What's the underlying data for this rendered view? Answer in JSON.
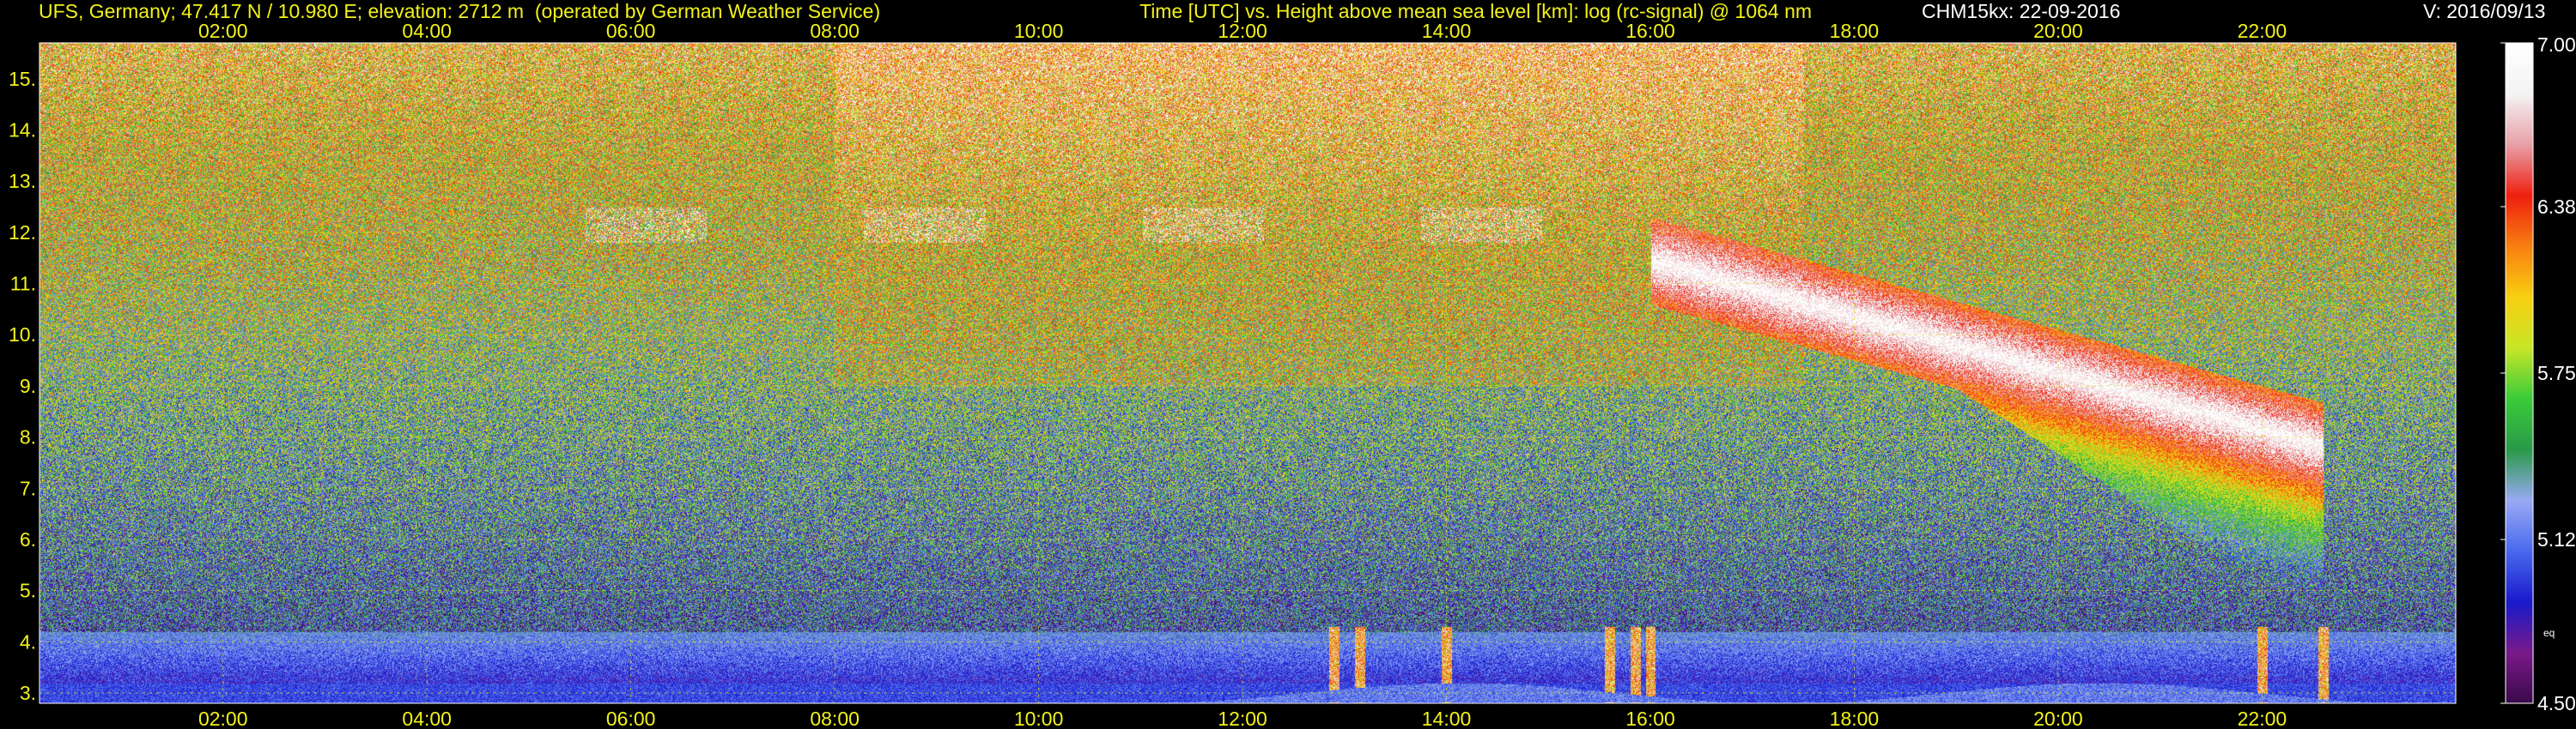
{
  "header": {
    "site": "UFS, Germany; 47.417 N / 10.980 E; elevation: 2712 m  (operated by German Weather Service)",
    "plot_title": "Time [UTC] vs. Height above mean sea level [km]: log (rc-signal) @ 1064 nm",
    "instrument": "CHM15kx: 22-09-2016",
    "version": "V: 2016/09/13"
  },
  "colors": {
    "background": "#000000",
    "axis_text": "#f2f21a",
    "grid": "#e0e020",
    "plot_frame": "#ffffff",
    "colorbar_stops": [
      "#3a0a4a",
      "#7a1a8a",
      "#1a1acc",
      "#4a6aee",
      "#9aaaf4",
      "#2a9a4a",
      "#3acc3a",
      "#c8e628",
      "#f8d010",
      "#f88010",
      "#f02010",
      "#e8a0a8",
      "#f4f4f4",
      "#ffffff"
    ]
  },
  "chart_data": {
    "type": "heatmap",
    "title": "Time [UTC] vs. Height above mean sea level [km]: log (rc-signal) @ 1064 nm",
    "x_axis": {
      "label": "Time [UTC]",
      "ticks": [
        "02:00",
        "04:00",
        "06:00",
        "08:00",
        "10:00",
        "12:00",
        "14:00",
        "16:00",
        "18:00",
        "20:00",
        "22:00"
      ],
      "range_hours": [
        0.2,
        23.9
      ],
      "grid": true
    },
    "y_axis": {
      "label": "Height above mean sea level [km]",
      "ticks": [
        "3.",
        "4.",
        "5.",
        "6.",
        "7.",
        "8.",
        "9.",
        "10.",
        "11.",
        "12.",
        "13.",
        "14.",
        "15."
      ],
      "range_km": [
        2.8,
        15.7
      ],
      "grid": true
    },
    "colorbar": {
      "ticks": [
        "4.50",
        "5.12",
        "5.75",
        "6.38",
        "7.00"
      ],
      "range": [
        4.5,
        7.0
      ],
      "label": "eq"
    },
    "features": [
      {
        "name": "cirrus thin patches",
        "time_hours": [
          4.5,
          17.5
        ],
        "height_km": [
          11.7,
          12.6
        ]
      },
      {
        "name": "cirrus cloud",
        "time_hours": [
          16.0,
          22.6
        ],
        "height_km": [
          6.7,
          12.4
        ]
      },
      {
        "name": "boundary layer aerosol",
        "time_hours": [
          11.5,
          23.9
        ],
        "height_km": [
          2.8,
          3.2
        ]
      },
      {
        "name": "precipitation streaks",
        "times_hours": [
          12.9,
          13.15,
          14.0,
          15.6,
          15.85,
          16.0,
          22.0,
          22.6
        ],
        "height_km": [
          2.8,
          4.3
        ]
      }
    ]
  }
}
